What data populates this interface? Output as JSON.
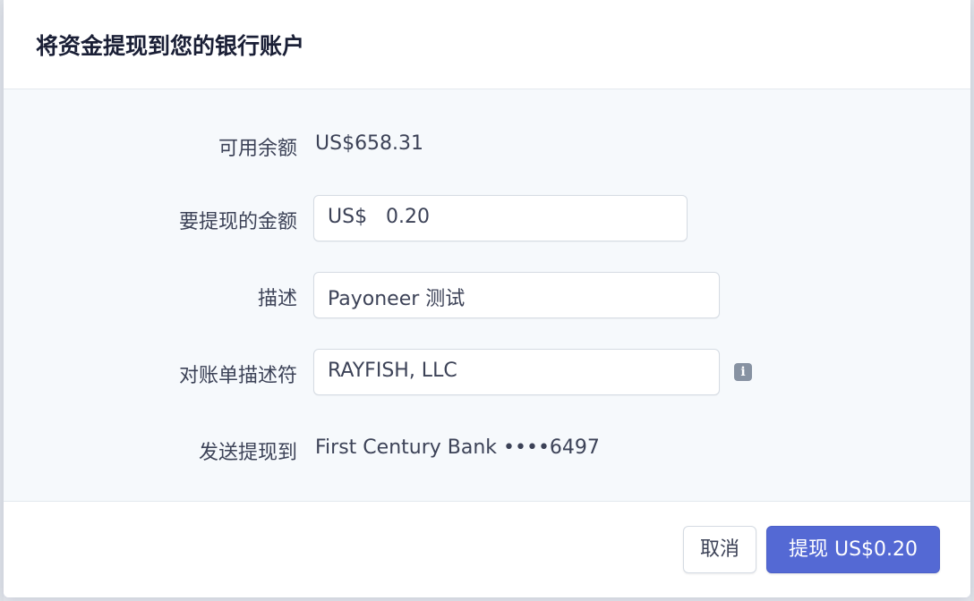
{
  "modal": {
    "title": "将资金提现到您的银行账户"
  },
  "form": {
    "available_balance": {
      "label": "可用余额",
      "value": "US$658.31"
    },
    "amount": {
      "label": "要提现的金额",
      "currency_prefix": "US$",
      "value": "0.20"
    },
    "description": {
      "label": "描述",
      "value": "Payoneer 测试"
    },
    "statement_descriptor": {
      "label": "对账单描述符",
      "value": "RAYFISH, LLC",
      "info_icon": "info-icon",
      "info_glyph": "i"
    },
    "send_to": {
      "label": "发送提现到",
      "value": "First Century Bank ••••6497"
    }
  },
  "footer": {
    "cancel_label": "取消",
    "submit_label": "提现 US$0.20"
  },
  "colors": {
    "primary": "#5469d4",
    "body_background": "#f6f9fc",
    "text": "#3c4257",
    "title": "#1a1f36",
    "border": "#d5dbe3",
    "icon": "#8792a2"
  }
}
